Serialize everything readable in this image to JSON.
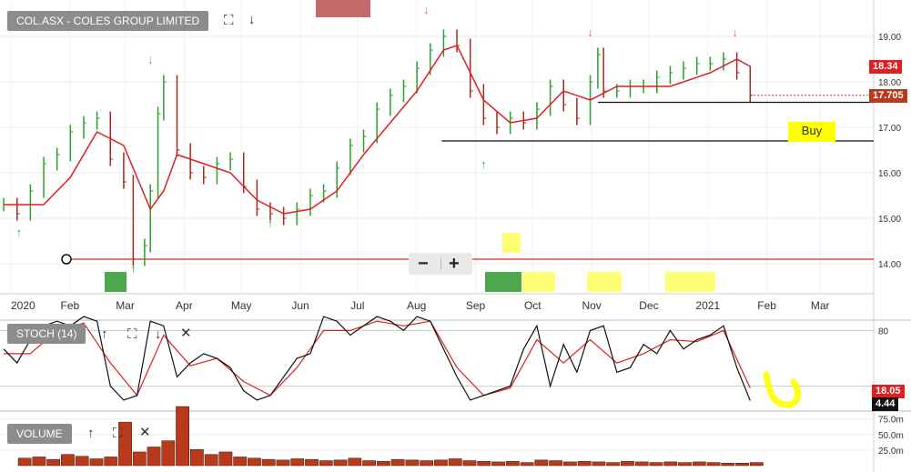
{
  "header": {
    "title": "COL.ASX - COLES GROUP LIMITED"
  },
  "toolbar": {
    "expand_icon": "expand-icon",
    "collapse_icon": "arrow-down-icon"
  },
  "zoom": {
    "minus_label": "−",
    "plus_label": "+"
  },
  "annotations": {
    "buy_label": "Buy"
  },
  "price_labels": {
    "ma_value": "18.34",
    "last_value": "17.705"
  },
  "stoch": {
    "title": "STOCH (14)",
    "tick": "80",
    "k_value": "4.44",
    "d_value": "18.05"
  },
  "volume": {
    "title": "VOLUME",
    "ticks": [
      "75.0m",
      "50.0m",
      "25.0m"
    ]
  },
  "colors": {
    "up": "#2e9e2e",
    "down": "#a52a1a",
    "ma": "#e02020",
    "highlight": "#ffff00",
    "stoch_d": "#e02020"
  },
  "chart_data": {
    "type": "line",
    "title": "COL.ASX - COLES GROUP LIMITED",
    "x_tick_labels": [
      "2020",
      "Feb",
      "Mar",
      "Apr",
      "May",
      "Jun",
      "Jul",
      "Aug",
      "Sep",
      "Oct",
      "Nov",
      "Dec",
      "2021",
      "Feb",
      "Mar"
    ],
    "y_tick_labels": [
      "19.00",
      "18.00",
      "17.00",
      "16.00",
      "15.00",
      "14.00"
    ],
    "ylim": [
      13.4,
      19.7
    ],
    "close": [
      [
        "2020-01-02",
        15.3
      ],
      [
        "2020-01-09",
        15.1
      ],
      [
        "2020-01-16",
        15.6
      ],
      [
        "2020-01-23",
        16.2
      ],
      [
        "2020-01-30",
        16.4
      ],
      [
        "2020-02-06",
        16.9
      ],
      [
        "2020-02-13",
        17.1
      ],
      [
        "2020-02-20",
        17.2
      ],
      [
        "2020-02-27",
        16.3
      ],
      [
        "2020-03-05",
        15.8
      ],
      [
        "2020-03-10",
        14.1
      ],
      [
        "2020-03-16",
        14.4
      ],
      [
        "2020-03-19",
        15.6
      ],
      [
        "2020-03-23",
        17.3
      ],
      [
        "2020-03-26",
        18.0
      ],
      [
        "2020-04-02",
        16.5
      ],
      [
        "2020-04-09",
        16.0
      ],
      [
        "2020-04-16",
        15.9
      ],
      [
        "2020-04-23",
        16.2
      ],
      [
        "2020-04-30",
        16.3
      ],
      [
        "2020-05-07",
        15.7
      ],
      [
        "2020-05-14",
        15.2
      ],
      [
        "2020-05-21",
        15.1
      ],
      [
        "2020-05-28",
        15.0
      ],
      [
        "2020-06-04",
        15.2
      ],
      [
        "2020-06-11",
        15.5
      ],
      [
        "2020-06-18",
        15.6
      ],
      [
        "2020-06-25",
        16.1
      ],
      [
        "2020-07-02",
        16.6
      ],
      [
        "2020-07-09",
        16.8
      ],
      [
        "2020-07-16",
        17.4
      ],
      [
        "2020-07-23",
        17.7
      ],
      [
        "2020-07-30",
        17.9
      ],
      [
        "2020-08-06",
        18.3
      ],
      [
        "2020-08-13",
        18.7
      ],
      [
        "2020-08-20",
        19.0
      ],
      [
        "2020-08-27",
        18.8
      ],
      [
        "2020-09-03",
        17.8
      ],
      [
        "2020-09-10",
        17.2
      ],
      [
        "2020-09-17",
        17.0
      ],
      [
        "2020-09-24",
        17.2
      ],
      [
        "2020-10-01",
        17.1
      ],
      [
        "2020-10-08",
        17.4
      ],
      [
        "2020-10-15",
        17.9
      ],
      [
        "2020-10-22",
        17.5
      ],
      [
        "2020-10-29",
        17.2
      ],
      [
        "2020-11-05",
        18.0
      ],
      [
        "2020-11-09",
        18.6
      ],
      [
        "2020-11-12",
        17.8
      ],
      [
        "2020-11-19",
        17.8
      ],
      [
        "2020-11-26",
        17.9
      ],
      [
        "2020-12-03",
        17.9
      ],
      [
        "2020-12-10",
        18.1
      ],
      [
        "2020-12-17",
        18.2
      ],
      [
        "2020-12-24",
        18.3
      ],
      [
        "2020-12-31",
        18.4
      ],
      [
        "2021-01-07",
        18.4
      ],
      [
        "2021-01-14",
        18.5
      ],
      [
        "2021-01-21",
        18.2
      ],
      [
        "2021-01-28",
        17.705
      ]
    ],
    "moving_average": [
      [
        "2020-01-02",
        15.3
      ],
      [
        "2020-01-23",
        15.3
      ],
      [
        "2020-02-06",
        15.9
      ],
      [
        "2020-02-20",
        16.9
      ],
      [
        "2020-03-05",
        16.6
      ],
      [
        "2020-03-19",
        15.2
      ],
      [
        "2020-03-26",
        15.6
      ],
      [
        "2020-04-02",
        16.4
      ],
      [
        "2020-04-16",
        16.2
      ],
      [
        "2020-04-30",
        16.0
      ],
      [
        "2020-05-14",
        15.4
      ],
      [
        "2020-05-28",
        15.1
      ],
      [
        "2020-06-11",
        15.2
      ],
      [
        "2020-06-25",
        15.6
      ],
      [
        "2020-07-09",
        16.4
      ],
      [
        "2020-07-23",
        17.1
      ],
      [
        "2020-08-06",
        17.8
      ],
      [
        "2020-08-20",
        18.7
      ],
      [
        "2020-08-27",
        18.8
      ],
      [
        "2020-09-10",
        17.6
      ],
      [
        "2020-09-24",
        17.1
      ],
      [
        "2020-10-08",
        17.2
      ],
      [
        "2020-10-22",
        17.8
      ],
      [
        "2020-11-05",
        17.6
      ],
      [
        "2020-11-19",
        17.9
      ],
      [
        "2020-12-17",
        17.9
      ],
      [
        "2021-01-07",
        18.2
      ],
      [
        "2021-01-21",
        18.5
      ],
      [
        "2021-01-28",
        18.34
      ]
    ],
    "horizontal_lines": [
      {
        "from": "2020-01-02",
        "to": "2021-03-31",
        "value": 14.1
      },
      {
        "from": "2020-08-19",
        "to": "2021-03-31",
        "value": 16.7
      },
      {
        "from": "2020-11-09",
        "to": "2021-03-31",
        "value": 17.55
      }
    ],
    "stoch_k": [
      [
        "2020-01-02",
        60
      ],
      [
        "2020-01-09",
        45
      ],
      [
        "2020-01-16",
        70
      ],
      [
        "2020-01-23",
        85
      ],
      [
        "2020-01-30",
        90
      ],
      [
        "2020-02-06",
        85
      ],
      [
        "2020-02-13",
        95
      ],
      [
        "2020-02-20",
        90
      ],
      [
        "2020-02-27",
        20
      ],
      [
        "2020-03-05",
        5
      ],
      [
        "2020-03-12",
        10
      ],
      [
        "2020-03-19",
        90
      ],
      [
        "2020-03-26",
        85
      ],
      [
        "2020-04-02",
        30
      ],
      [
        "2020-04-09",
        45
      ],
      [
        "2020-04-16",
        55
      ],
      [
        "2020-04-23",
        50
      ],
      [
        "2020-04-30",
        40
      ],
      [
        "2020-05-07",
        15
      ],
      [
        "2020-05-14",
        5
      ],
      [
        "2020-05-21",
        10
      ],
      [
        "2020-05-28",
        30
      ],
      [
        "2020-06-04",
        50
      ],
      [
        "2020-06-11",
        55
      ],
      [
        "2020-06-18",
        95
      ],
      [
        "2020-06-25",
        90
      ],
      [
        "2020-07-02",
        75
      ],
      [
        "2020-07-09",
        85
      ],
      [
        "2020-07-16",
        95
      ],
      [
        "2020-07-23",
        90
      ],
      [
        "2020-07-30",
        80
      ],
      [
        "2020-08-06",
        95
      ],
      [
        "2020-08-13",
        90
      ],
      [
        "2020-08-20",
        60
      ],
      [
        "2020-08-27",
        30
      ],
      [
        "2020-09-03",
        5
      ],
      [
        "2020-09-10",
        10
      ],
      [
        "2020-09-17",
        15
      ],
      [
        "2020-09-24",
        20
      ],
      [
        "2020-10-01",
        60
      ],
      [
        "2020-10-08",
        85
      ],
      [
        "2020-10-15",
        20
      ],
      [
        "2020-10-22",
        65
      ],
      [
        "2020-10-29",
        35
      ],
      [
        "2020-11-05",
        80
      ],
      [
        "2020-11-12",
        85
      ],
      [
        "2020-11-19",
        35
      ],
      [
        "2020-11-26",
        40
      ],
      [
        "2020-12-03",
        65
      ],
      [
        "2020-12-10",
        55
      ],
      [
        "2020-12-17",
        80
      ],
      [
        "2020-12-24",
        60
      ],
      [
        "2020-12-31",
        70
      ],
      [
        "2021-01-07",
        75
      ],
      [
        "2021-01-14",
        85
      ],
      [
        "2021-01-21",
        40
      ],
      [
        "2021-01-28",
        4.44
      ]
    ],
    "stoch_d": [
      [
        "2020-01-02",
        55
      ],
      [
        "2020-01-16",
        55
      ],
      [
        "2020-01-30",
        80
      ],
      [
        "2020-02-13",
        88
      ],
      [
        "2020-02-27",
        45
      ],
      [
        "2020-03-12",
        10
      ],
      [
        "2020-03-26",
        75
      ],
      [
        "2020-04-09",
        42
      ],
      [
        "2020-04-23",
        50
      ],
      [
        "2020-05-07",
        25
      ],
      [
        "2020-05-21",
        10
      ],
      [
        "2020-06-04",
        40
      ],
      [
        "2020-06-18",
        80
      ],
      [
        "2020-07-02",
        80
      ],
      [
        "2020-07-16",
        90
      ],
      [
        "2020-07-30",
        85
      ],
      [
        "2020-08-13",
        90
      ],
      [
        "2020-08-27",
        40
      ],
      [
        "2020-09-10",
        10
      ],
      [
        "2020-09-24",
        18
      ],
      [
        "2020-10-08",
        70
      ],
      [
        "2020-10-22",
        45
      ],
      [
        "2020-11-05",
        70
      ],
      [
        "2020-11-19",
        45
      ],
      [
        "2020-12-03",
        55
      ],
      [
        "2020-12-17",
        70
      ],
      [
        "2020-12-31",
        68
      ],
      [
        "2021-01-14",
        80
      ],
      [
        "2021-01-28",
        18.05
      ]
    ],
    "stoch_ylim": [
      0,
      100
    ],
    "volume": [
      12,
      14,
      10,
      18,
      15,
      11,
      14,
      70,
      22,
      30,
      40,
      95,
      26,
      18,
      22,
      14,
      12,
      10,
      9,
      11,
      10,
      8,
      9,
      12,
      8,
      7,
      10,
      9,
      8,
      9,
      11,
      8,
      7,
      6,
      7,
      5,
      9,
      8,
      6,
      7,
      6,
      5,
      7,
      6,
      5,
      6,
      5,
      6,
      5,
      4,
      4,
      5
    ],
    "volume_ylim": [
      0,
      100
    ]
  }
}
